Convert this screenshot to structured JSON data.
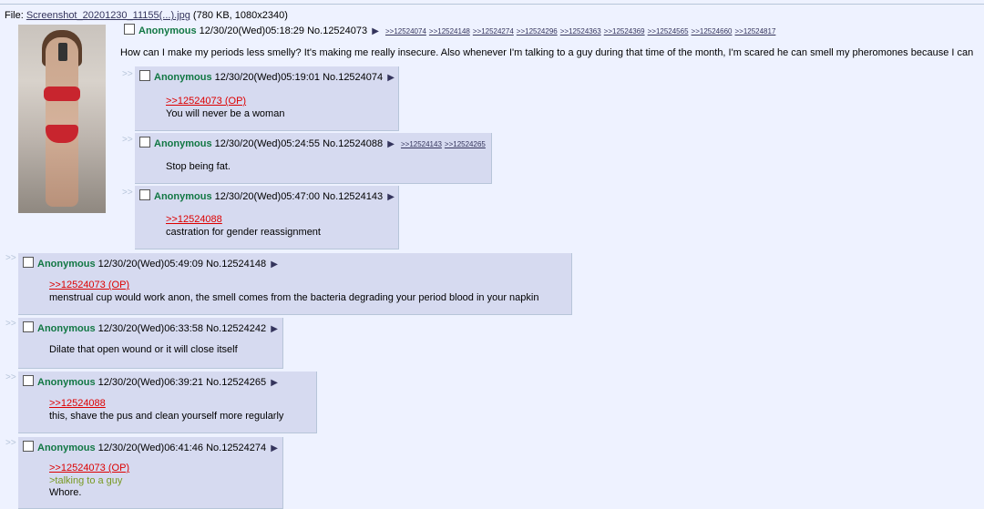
{
  "file": {
    "prefix": "File: ",
    "filename": "Screenshot_20201230_11155(...).jpg",
    "meta": " (780 KB, 1080x2340)"
  },
  "op": {
    "name": "Anonymous",
    "datetime": "12/30/20(Wed)05:18:29",
    "number": "No.12524073",
    "backlinks": [
      ">>12524074",
      ">>12524148",
      ">>12524274",
      ">>12524296",
      ">>12524363",
      ">>12524369",
      ">>12524565",
      ">>12524660",
      ">>12524817"
    ],
    "message": "How can I make my periods less smelly? It's making me really insecure. Also whenever I'm talking to a guy during that time of the month, I'm scared he can smell my pheromones because I can"
  },
  "replies": [
    {
      "name": "Anonymous",
      "datetime": "12/30/20(Wed)05:19:01",
      "number": "No.12524074",
      "quote": ">>12524073 (OP)",
      "line1": "You will never be a woman"
    },
    {
      "name": "Anonymous",
      "datetime": "12/30/20(Wed)05:24:55",
      "number": "No.12524088",
      "backlinks": [
        ">>12524143",
        ">>12524265"
      ],
      "line1": "Stop being fat."
    },
    {
      "name": "Anonymous",
      "datetime": "12/30/20(Wed)05:47:00",
      "number": "No.12524143",
      "quote": ">>12524088",
      "line1": "castration for gender reassignment"
    },
    {
      "name": "Anonymous",
      "datetime": "12/30/20(Wed)05:49:09",
      "number": "No.12524148",
      "quote": ">>12524073 (OP)",
      "line1": "menstrual cup would work anon, the smell comes from the bacteria degrading your period blood in your napkin"
    },
    {
      "name": "Anonymous",
      "datetime": "12/30/20(Wed)06:33:58",
      "number": "No.12524242",
      "line1": "Dilate that open wound or it will close itself"
    },
    {
      "name": "Anonymous",
      "datetime": "12/30/20(Wed)06:39:21",
      "number": "No.12524265",
      "quote": ">>12524088",
      "line1": "this, shave the pus and clean yourself more regularly"
    },
    {
      "name": "Anonymous",
      "datetime": "12/30/20(Wed)06:41:46",
      "number": "No.12524274",
      "quote": ">>12524073 (OP)",
      "greentext": ">talking to a guy",
      "line2": "Whore."
    }
  ],
  "reply_arrows": ">>",
  "icons": {
    "post_menu": "triangle-right-icon",
    "select": "checkbox"
  },
  "colors": {
    "name": "#117743",
    "quotelink": "#dd0000",
    "greentext": "#789922",
    "reply_bg": "#d6daf0",
    "page_bg": "#eef2ff"
  }
}
